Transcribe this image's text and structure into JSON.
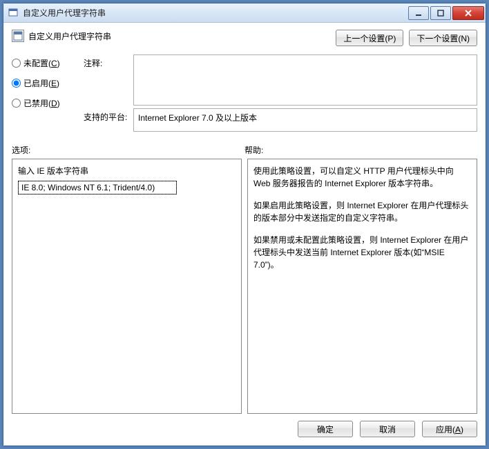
{
  "window": {
    "title": "自定义用户代理字符串"
  },
  "header": {
    "title": "自定义用户代理字符串",
    "prev_label": "上一个设置(P)",
    "next_label": "下一个设置(N)"
  },
  "radios": {
    "not_configured": "未配置(C)",
    "enabled": "已启用(E)",
    "disabled": "已禁用(D)",
    "selected": "enabled"
  },
  "meta": {
    "comment_label": "注释:",
    "comment_value": "",
    "platform_label": "支持的平台:",
    "platform_text": "Internet Explorer 7.0 及以上版本"
  },
  "labels": {
    "options": "选项:",
    "help": "帮助:"
  },
  "options": {
    "field_label": "输入 IE 版本字符串",
    "field_value": "IE 8.0; Windows NT 6.1; Trident/4.0)"
  },
  "help": {
    "p1": "使用此策略设置，可以自定义 HTTP 用户代理标头中向 Web 服务器报告的 Internet Explorer 版本字符串。",
    "p2": "如果启用此策略设置，则 Internet Explorer 在用户代理标头的版本部分中发送指定的自定义字符串。",
    "p3": "如果禁用或未配置此策略设置，则 Internet Explorer 在用户代理标头中发送当前 Internet Explorer 版本(如“MSIE 7.0”)。"
  },
  "footer": {
    "ok": "确定",
    "cancel": "取消",
    "apply": "应用(A)"
  }
}
